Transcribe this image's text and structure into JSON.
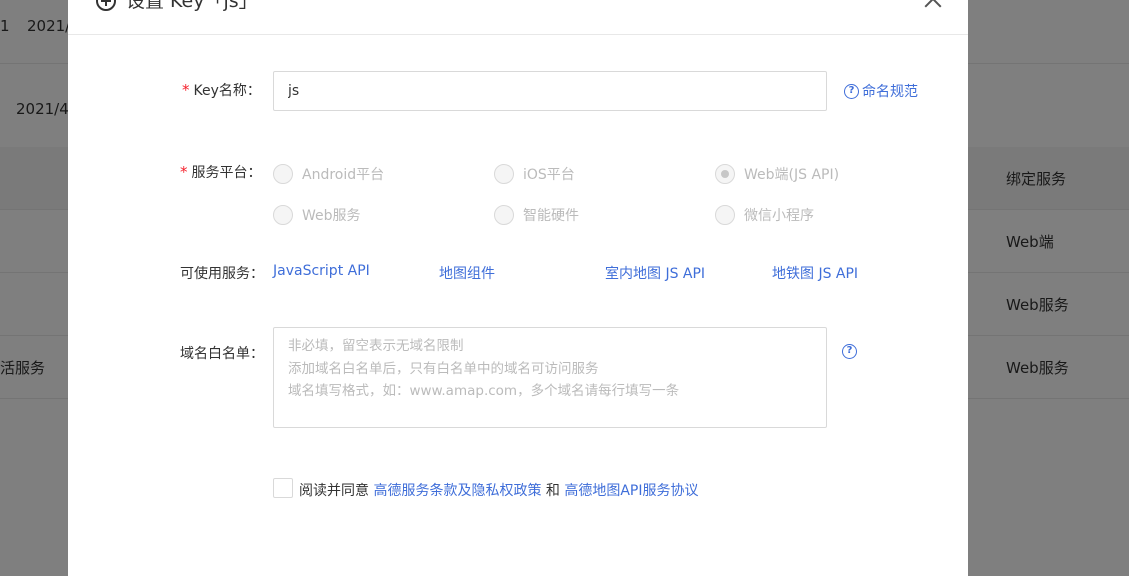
{
  "background": {
    "row1": {
      "col0": "1",
      "col1": "2021/"
    },
    "row2": {
      "col1": "2021/4"
    },
    "rows": [
      {
        "left": "",
        "service": "绑定服务"
      },
      {
        "left": "",
        "service": "Web端"
      },
      {
        "left": "",
        "service": "Web服务"
      },
      {
        "left": "活服务",
        "service": "Web服务"
      }
    ]
  },
  "modal": {
    "title": "设置 Key「js」",
    "key_name": {
      "label": "Key名称：",
      "value": "js",
      "help": "命名规范"
    },
    "platform": {
      "label": "服务平台：",
      "options": [
        {
          "label": "Android平台",
          "checked": false
        },
        {
          "label": "iOS平台",
          "checked": false
        },
        {
          "label": "Web端(JS API)",
          "checked": true
        },
        {
          "label": "Web服务",
          "checked": false
        },
        {
          "label": "智能硬件",
          "checked": false
        },
        {
          "label": "微信小程序",
          "checked": false
        }
      ]
    },
    "services": {
      "label": "可使用服务：",
      "items": [
        "JavaScript API",
        "地图组件",
        "室内地图 JS API",
        "地铁图 JS API"
      ]
    },
    "whitelist": {
      "label": "域名白名单：",
      "placeholder": "非必填，留空表示无域名限制\n添加域名白名单后，只有白名单中的域名可访问服务\n域名填写格式，如：www.amap.com，多个域名请每行填写一条"
    },
    "agreement": {
      "prefix": "阅读并同意 ",
      "terms_link": "高德服务条款及隐私权政策",
      "middle": " 和 ",
      "api_link": "高德地图API服务协议"
    }
  },
  "colors": {
    "link": "#3f6ed9",
    "required": "#f5222d",
    "overlay": "rgba(0,0,0,0.5)"
  }
}
